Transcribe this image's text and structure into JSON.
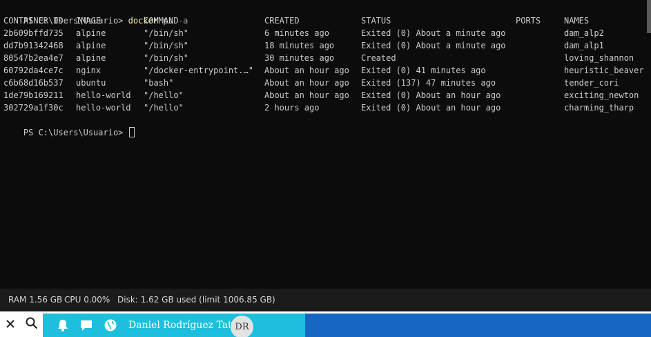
{
  "terminal": {
    "prompt": "PS C:\\Users\\Usuario>",
    "command": "docker",
    "command_args": "ps",
    "command_flag": "-a",
    "headers": [
      "CONTAINER ID",
      "IMAGE",
      "COMMAND",
      "CREATED",
      "STATUS",
      "PORTS",
      "NAMES"
    ],
    "rows": [
      [
        "2b609bffd735",
        "alpine",
        "\"/bin/sh\"",
        "6 minutes ago",
        "Exited (0) About a minute ago",
        "",
        "dam_alp2"
      ],
      [
        "dd7b91342468",
        "alpine",
        "\"/bin/sh\"",
        "18 minutes ago",
        "Exited (0) About a minute ago",
        "",
        "dam_alp1"
      ],
      [
        "80547b2ea4e7",
        "alpine",
        "\"/bin/sh\"",
        "30 minutes ago",
        "Created",
        "",
        "loving_shannon"
      ],
      [
        "60792da4ce7c",
        "nginx",
        "\"/docker-entrypoint.…\"",
        "About an hour ago",
        "Exited (0) 41 minutes ago",
        "",
        "heuristic_beaver"
      ],
      [
        "c6b68d16b537",
        "ubuntu",
        "\"bash\"",
        "About an hour ago",
        "Exited (137) 47 minutes ago",
        "",
        "tender_cori"
      ],
      [
        "1de79b169211",
        "hello-world",
        "\"/hello\"",
        "About an hour ago",
        "Exited (0) About an hour ago",
        "",
        "exciting_newton"
      ],
      [
        "302729a1f30c",
        "hello-world",
        "\"/hello\"",
        "2 hours ago",
        "Exited (0) About an hour ago",
        "",
        "charming_tharp"
      ]
    ],
    "final_prompt": "PS C:\\Users\\Usuario>"
  },
  "statusbar": {
    "ram": "RAM 1.56 GB",
    "cpu": "CPU 0.00%",
    "disk": "Disk: 1.62 GB used (limit 1006.85 GB)"
  },
  "taskbar": {
    "user_name": "Daniel Rodríguez Tato",
    "avatar_initials": "DR",
    "icons": [
      "close-icon",
      "search-icon",
      "bell-icon",
      "chat-icon",
      "globe-icon"
    ]
  },
  "colors": {
    "terminal_bg": "#0c0c0c",
    "terminal_fg": "#cccccc",
    "command_yellow": "#f9f1a5",
    "statusbar_bg": "#1b1b1b",
    "taskbar_cyan": "#1ebfdc",
    "taskbar_blue": "#1766c4"
  }
}
